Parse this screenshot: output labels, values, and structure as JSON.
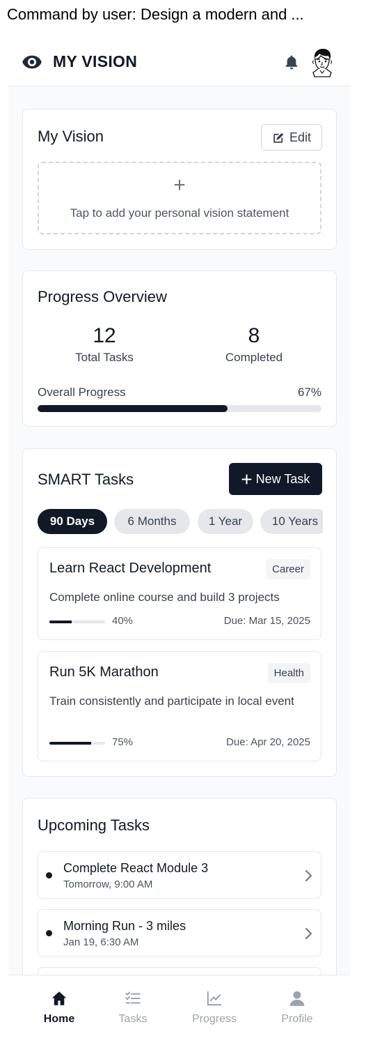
{
  "caption": "Command by user: Design a modern and ...",
  "header": {
    "brand": "MY VISION",
    "brand_icon": "eye-icon",
    "notification_icon": "bell-icon",
    "avatar_icon": "avatar"
  },
  "vision": {
    "title": "My Vision",
    "edit_label": "Edit",
    "add_icon": "+",
    "placeholder": "Tap to add your personal vision statement"
  },
  "progress": {
    "title": "Progress Overview",
    "total_value": "12",
    "total_label": "Total Tasks",
    "completed_value": "8",
    "completed_label": "Completed",
    "overall_label": "Overall Progress",
    "overall_percent": "67%",
    "overall_fraction": 0.67
  },
  "smart": {
    "title": "SMART Tasks",
    "new_task_label": "New Task",
    "tabs": [
      {
        "label": "90 Days",
        "active": true
      },
      {
        "label": "6 Months",
        "active": false
      },
      {
        "label": "1 Year",
        "active": false
      },
      {
        "label": "10 Years",
        "active": false
      }
    ],
    "tasks": [
      {
        "title": "Learn React Development",
        "category": "Career",
        "description": "Complete online course and build 3 projects",
        "percent_label": "40%",
        "progress": 0.4,
        "due": "Due: Mar 15, 2025"
      },
      {
        "title": "Run 5K Marathon",
        "category": "Health",
        "description": "Train consistently and participate in local event",
        "percent_label": "75%",
        "progress": 0.75,
        "due": "Due: Apr 20, 2025"
      }
    ]
  },
  "upcoming": {
    "title": "Upcoming Tasks",
    "items": [
      {
        "title": "Complete React Module 3",
        "time": "Tomorrow, 9:00 AM"
      },
      {
        "title": "Morning Run - 3 miles",
        "time": "Jan 19, 6:30 AM"
      },
      {
        "title": "",
        "time": ""
      }
    ]
  },
  "nav": {
    "items": [
      {
        "label": "Home",
        "icon": "home-icon",
        "active": true
      },
      {
        "label": "Tasks",
        "icon": "tasks-icon",
        "active": false
      },
      {
        "label": "Progress",
        "icon": "chart-line-icon",
        "active": false
      },
      {
        "label": "Profile",
        "icon": "user-icon",
        "active": false
      }
    ]
  },
  "colors": {
    "primary": "#111827",
    "muted": "#9ca3af",
    "border": "#e5e7eb",
    "background": "#f9fafb"
  }
}
